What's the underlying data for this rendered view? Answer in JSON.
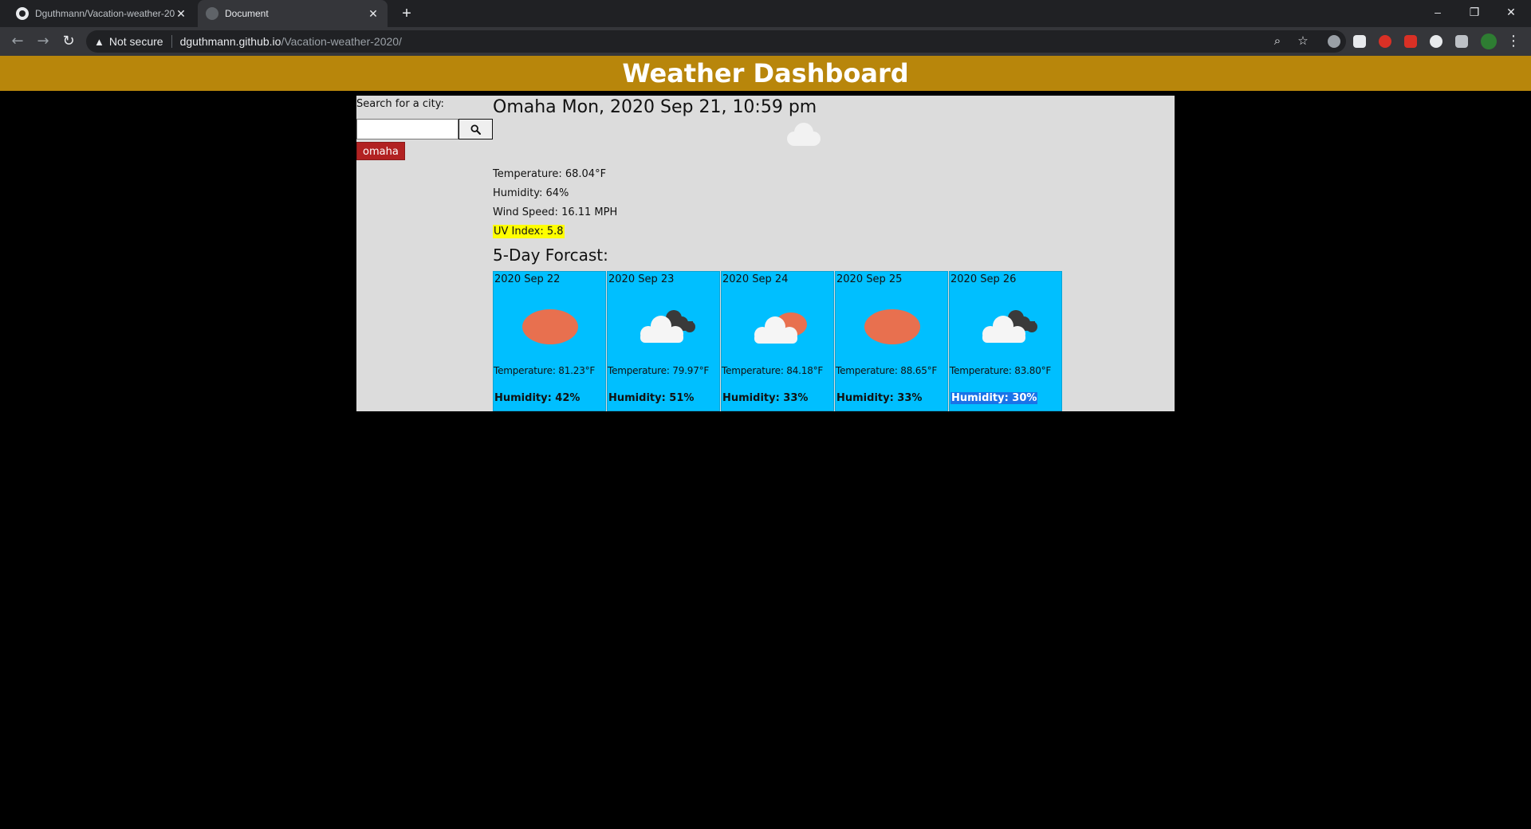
{
  "browser": {
    "tabs": [
      {
        "title": "Dguthmann/Vacation-weather-2020",
        "active": false
      },
      {
        "title": "Document",
        "active": true
      }
    ],
    "security_label": "Not secure",
    "url_host": "dguthmann.github.io",
    "url_path": "/Vacation-weather-2020/"
  },
  "header": {
    "title": "Weather Dashboard"
  },
  "search": {
    "label": "Search for a city:",
    "value": "",
    "button_icon": "search-icon"
  },
  "history": [
    "omaha"
  ],
  "current": {
    "title": "Omaha Mon, 2020 Sep 21, 10:59 pm",
    "icon": "cloud-icon",
    "temperature": "Temperature: 68.04°F",
    "humidity": "Humidity: 64%",
    "wind": "Wind Speed: 16.11 MPH",
    "uv": "UV Index: 5.8",
    "uv_color": "#ffff00"
  },
  "forecast": {
    "title": "5-Day Forcast:",
    "days": [
      {
        "date": "2020 Sep 22",
        "icon": "sun-icon",
        "temperature": "Temperature: 81.23°F",
        "humidity": "Humidity: 42%"
      },
      {
        "date": "2020 Sep 23",
        "icon": "cloudy-icon",
        "temperature": "Temperature: 79.97°F",
        "humidity": "Humidity: 51%"
      },
      {
        "date": "2020 Sep 24",
        "icon": "partly-cloudy-icon",
        "temperature": "Temperature: 84.18°F",
        "humidity": "Humidity: 33%"
      },
      {
        "date": "2020 Sep 25",
        "icon": "sun-icon",
        "temperature": "Temperature: 88.65°F",
        "humidity": "Humidity: 33%"
      },
      {
        "date": "2020 Sep 26",
        "icon": "cloudy-icon",
        "temperature": "Temperature: 83.80°F",
        "humidity": "Humidity: 30%"
      }
    ]
  },
  "colors": {
    "header": "#b8860b",
    "card": "#00bfff",
    "history_button": "#b22222",
    "sun": "#e8704f"
  }
}
